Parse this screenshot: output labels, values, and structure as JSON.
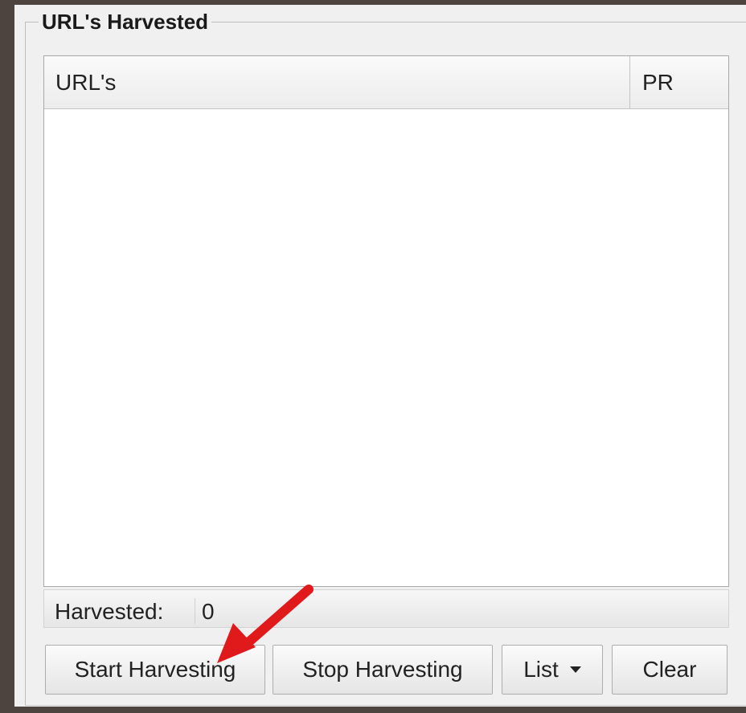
{
  "group": {
    "title": "URL's Harvested"
  },
  "table": {
    "columns": [
      "URL's",
      "PR"
    ],
    "rows": []
  },
  "status": {
    "label": "Harvested:",
    "count": "0"
  },
  "buttons": {
    "start": "Start Harvesting",
    "stop": "Stop Harvesting",
    "list": "List",
    "clear": "Clear"
  },
  "annotation": {
    "arrow_color": "#e0191b",
    "points_to": "start-harvesting-button"
  }
}
